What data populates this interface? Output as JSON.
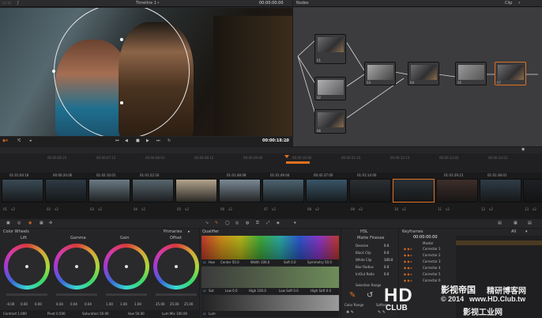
{
  "viewer": {
    "timeline_name": "Timeline 1",
    "timecode_top": "00:00:00:00",
    "timecode": "00:00:18:20"
  },
  "nodes": {
    "title": "Nodes",
    "clip_label": "Clip",
    "items": [
      "01",
      "02",
      "03",
      "04",
      "05",
      "06",
      "07"
    ]
  },
  "ruler": [
    "00:00:06:23",
    "00:00:07:15",
    "00:00:08:01",
    "00:00:08:12",
    "00:00:09:04",
    "00:00:10:00",
    "00:00:11:10",
    "00:00:12:13",
    "00:00:13:02",
    "00:00:14:01"
  ],
  "clips": [
    {
      "tc": "01:01:04:18",
      "label": "01",
      "tag": "v2"
    },
    {
      "tc": "00:00:20:06",
      "label": "02",
      "tag": "v2"
    },
    {
      "tc": "01:02:10:01",
      "label": "03",
      "tag": "v2"
    },
    {
      "tc": "01:01:22:16",
      "label": "04",
      "tag": "v2"
    },
    {
      "tc": "",
      "label": "05",
      "tag": "v2"
    },
    {
      "tc": "01:01:48:08",
      "label": "06",
      "tag": "v2"
    },
    {
      "tc": "01:01:49:04",
      "label": "07",
      "tag": "v2"
    },
    {
      "tc": "00:42:37:00",
      "label": "08",
      "tag": "v2"
    },
    {
      "tc": "01:01:14:00",
      "label": "09",
      "tag": "v2"
    },
    {
      "tc": "",
      "label": "10",
      "tag": "v2"
    },
    {
      "tc": "01:01:29:21",
      "label": "11",
      "tag": "v2"
    },
    {
      "tc": "01:01:38:01",
      "label": "12",
      "tag": "v2"
    },
    {
      "tc": "",
      "label": "13",
      "tag": "v2"
    }
  ],
  "color_wheels": {
    "title": "Color Wheels",
    "mode": "Primaries",
    "wheels": [
      {
        "name": "Lift",
        "values": [
          "-0.00",
          "0.00",
          "0.00"
        ]
      },
      {
        "name": "Gamma",
        "values": [
          "0.04",
          "0.04",
          "0.04"
        ]
      },
      {
        "name": "Gain",
        "values": [
          "1.00",
          "1.00",
          "1.00"
        ]
      },
      {
        "name": "Offset",
        "values": [
          "25.00",
          "25.00",
          "25.00"
        ]
      }
    ],
    "bottom": {
      "contrast": "Contrast 1.000",
      "pivot": "Pivot 0.500",
      "saturation": "Saturation 50.00",
      "hue": "Hue 50.00",
      "lum_mix": "Lum Mix 100.00"
    }
  },
  "qualifier": {
    "title": "Qualifier",
    "hue_label": "Hue",
    "center": "Center 50.0",
    "width": "Width 100.0",
    "soft": "Soft 0.0",
    "symmetry": "Symmetry 50.0",
    "sat_label": "Sat",
    "low": "Low 0.0",
    "high": "High 100.0",
    "low_soft": "Low Soft 0.0",
    "high_soft": "High Soft 0.0",
    "lum_label": "Lum"
  },
  "matte": {
    "title": "Matte Finesse",
    "mode": "HSL",
    "rows": [
      {
        "k": "Denoise",
        "v": "0.0"
      },
      {
        "k": "Black Clip",
        "v": "0.0"
      },
      {
        "k": "White Clip",
        "v": "100.0"
      },
      {
        "k": "Blur Radius",
        "v": "0.0"
      },
      {
        "k": "In/Out Ratio",
        "v": "0.0"
      }
    ],
    "selection_range": "Selection Range",
    "color_range": "Color Range",
    "softness": "Softness"
  },
  "keyframes": {
    "title": "Keyframes",
    "timecode": "00:00:00:00",
    "filter": "All",
    "master": "Master",
    "rows": [
      "Corrector 1",
      "Corrector 2",
      "Corrector 3",
      "Corrector 4",
      "Corrector 5",
      "Corrector 6"
    ]
  },
  "watermark": {
    "brand": "HD",
    "club": "CLUB",
    "cn_title": "影视帝国",
    "cn_sub": "精研博客网",
    "copyright": "© 2014",
    "url": "www.HD.Club.tw",
    "cn_bottom": "影视工业网"
  }
}
